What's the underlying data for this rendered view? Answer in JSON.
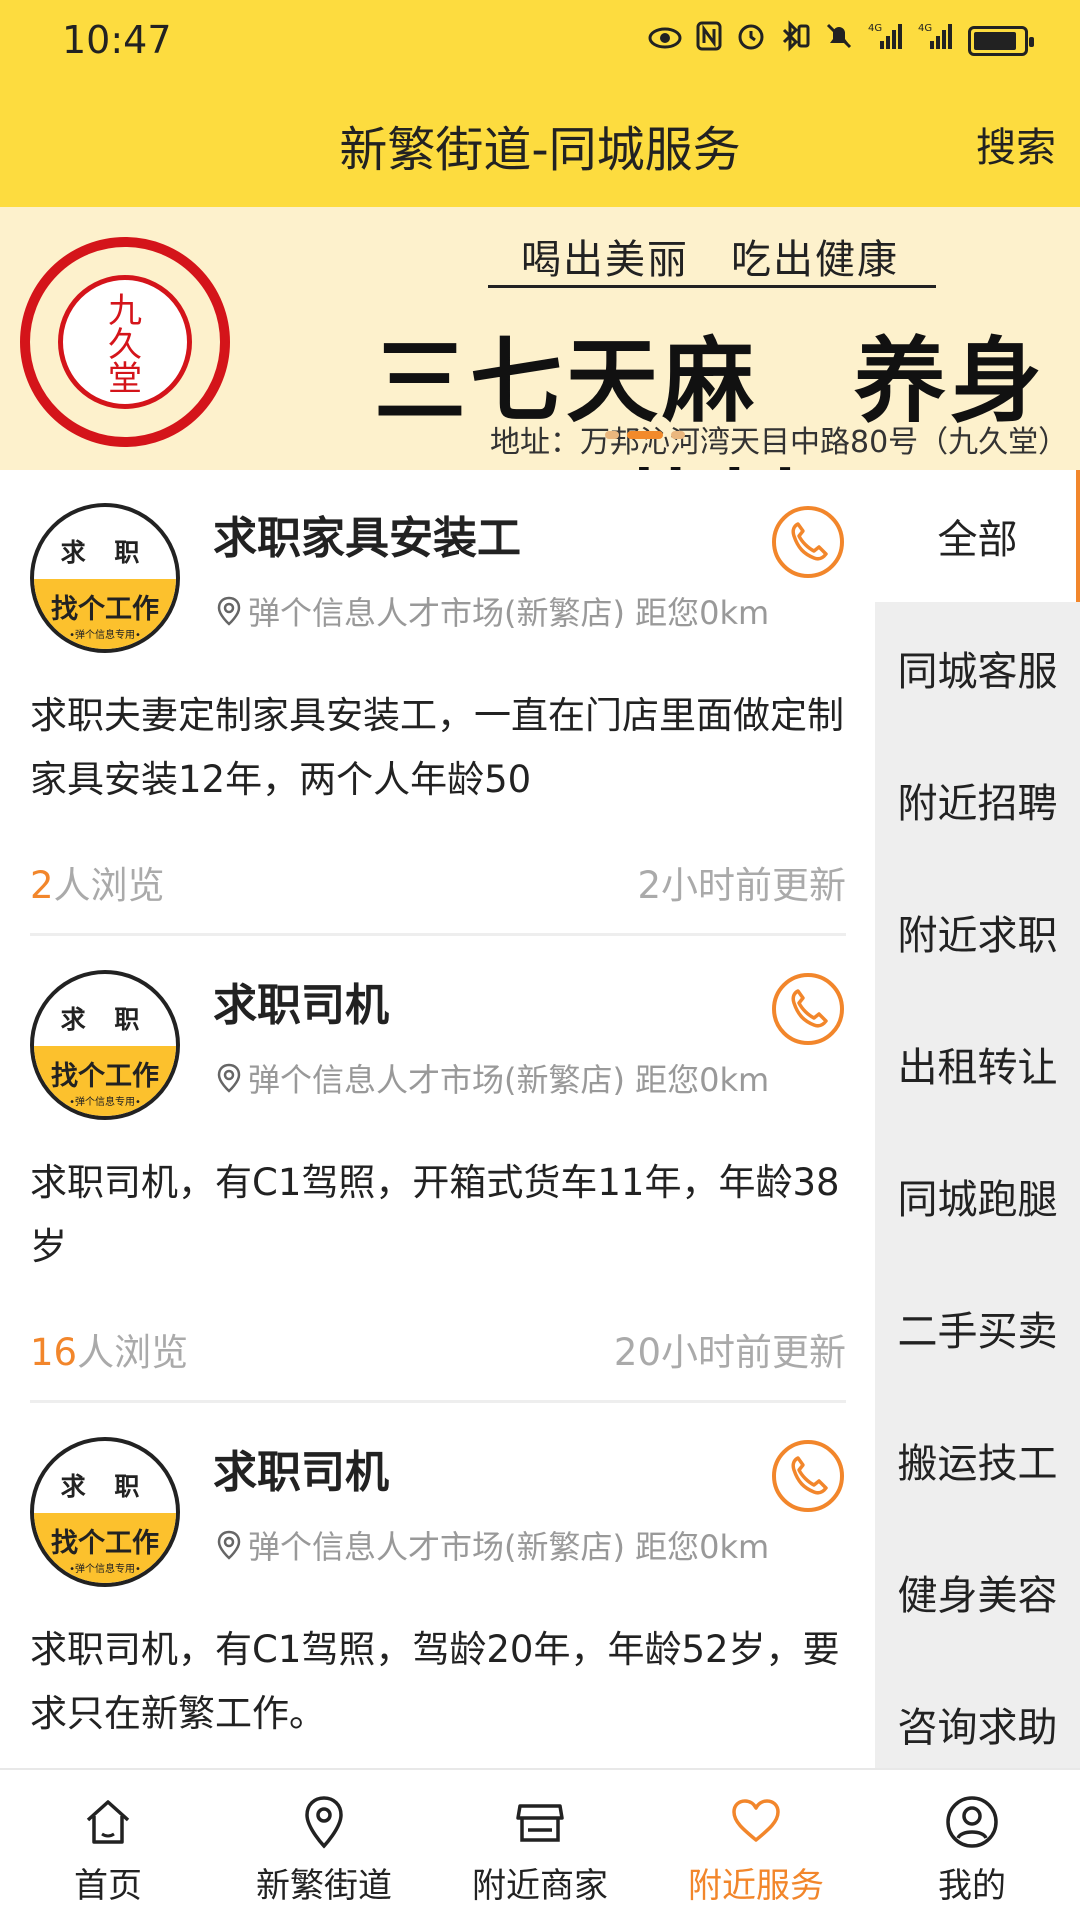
{
  "status_bar": {
    "time": "10:47",
    "icons": [
      "eye-icon",
      "nfc-icon",
      "alarm-icon",
      "bluetooth-icon",
      "mute-icon",
      "signal-4g-icon",
      "signal-4g-icon",
      "battery-charging-icon"
    ],
    "signal_label_1": "4G",
    "signal_label_2": "4G"
  },
  "header": {
    "title": "新繁街道-同城服务",
    "search_label": "搜索",
    "background_color": "#fddc3f"
  },
  "banner": {
    "seal_text": "九久堂",
    "slogan": "喝出美丽　吃出健康",
    "headline": "三七天麻　养身药材",
    "address": "地址：万邦沁河湾天目中路80号（九久堂）",
    "active_slide": 1,
    "slide_count": 3
  },
  "listings": [
    {
      "avatar_top": "求 职",
      "avatar_bottom": "找个工作",
      "avatar_caption": "•弹个信息专用•",
      "title": "求职家具安装工",
      "location": "弹个信息人才市场(新繁店) 距您0km",
      "description": "求职夫妻定制家具安装工，一直在门店里面做定制家具安装12年，两个人年龄50",
      "views_count": "2",
      "views_suffix": "人浏览",
      "updated": "2小时前更新"
    },
    {
      "avatar_top": "求 职",
      "avatar_bottom": "找个工作",
      "avatar_caption": "•弹个信息专用•",
      "title": "求职司机",
      "location": "弹个信息人才市场(新繁店) 距您0km",
      "description": "求职司机，有C1驾照，开箱式货车11年，年龄38岁",
      "views_count": "16",
      "views_suffix": "人浏览",
      "updated": "20小时前更新"
    },
    {
      "avatar_top": "求 职",
      "avatar_bottom": "找个工作",
      "avatar_caption": "•弹个信息专用•",
      "title": "求职司机",
      "location": "弹个信息人才市场(新繁店) 距您0km",
      "description": "求职司机，有C1驾照，驾龄20年，年龄52岁，要求只在新繁工作。",
      "views_count": "",
      "views_suffix": "",
      "updated": ""
    }
  ],
  "sidebar": {
    "items": [
      {
        "label": "全部",
        "active": true
      },
      {
        "label": "同城客服"
      },
      {
        "label": "附近招聘"
      },
      {
        "label": "附近求职"
      },
      {
        "label": "出租转让"
      },
      {
        "label": "同城跑腿"
      },
      {
        "label": "二手买卖"
      },
      {
        "label": "搬运技工"
      },
      {
        "label": "健身美容"
      },
      {
        "label": "咨询求助"
      }
    ]
  },
  "bottom_nav": {
    "items": [
      {
        "label": "首页",
        "icon": "home-icon"
      },
      {
        "label": "新繁街道",
        "icon": "location-pin-icon"
      },
      {
        "label": "附近商家",
        "icon": "store-icon"
      },
      {
        "label": "附近服务",
        "icon": "heart-icon",
        "active": true
      },
      {
        "label": "我的",
        "icon": "user-icon"
      }
    ]
  },
  "colors": {
    "accent": "#f2862b",
    "header_yellow": "#fddc3f",
    "seal_red": "#d4141a",
    "sidebar_bg": "#eeeeee"
  }
}
